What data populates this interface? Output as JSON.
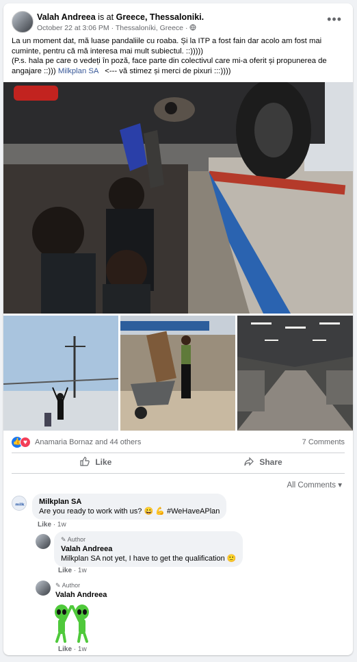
{
  "post": {
    "author": "Valah Andreea",
    "is_at_text": "is at",
    "location": "Greece, Thessaloniki.",
    "date": "October 22 at 3:06 PM",
    "place": "Thessaloníki, Greece",
    "text_lines": [
      "La un moment dat, mă luase pandaliile cu roaba. Și la ITP a fost fain dar acolo am fost mai cuminte, pentru că mă interesa mai mult subiectul. ::)))))",
      "(P.s. hala pe care o vedeți în poză, face parte din colectivul care mi-a oferit și propunerea de angajare ::)))"
    ],
    "mention": "Milkplan SA",
    "text_tail": "<--- vă stimez și merci de pixuri :::))))"
  },
  "reactions": {
    "names": "Anamaria Bornaz and 44 others",
    "comments_count": "7 Comments"
  },
  "actions": {
    "like": "Like",
    "share": "Share"
  },
  "comments_sort": "All Comments",
  "comments": [
    {
      "name": "Milkplan SA",
      "text": "Are you ready to work with us? 😀 💪 #WeHaveAPlan",
      "like": "Like",
      "time": "1w"
    },
    {
      "author_tag": "Author",
      "name": "Valah Andreea",
      "text": "Milkplan SA not yet, I have to get the qualification 🙂",
      "like": "Like",
      "time": "1w"
    },
    {
      "author_tag": "Author",
      "name": "Valah Andreea",
      "sticker": "two-aliens-high-five-sticker",
      "like": "Like",
      "time": "1w"
    }
  ],
  "colors": {
    "link": "#385898",
    "like_blue": "#1877f2",
    "love_red": "#f33e58",
    "muted": "#65676b"
  }
}
